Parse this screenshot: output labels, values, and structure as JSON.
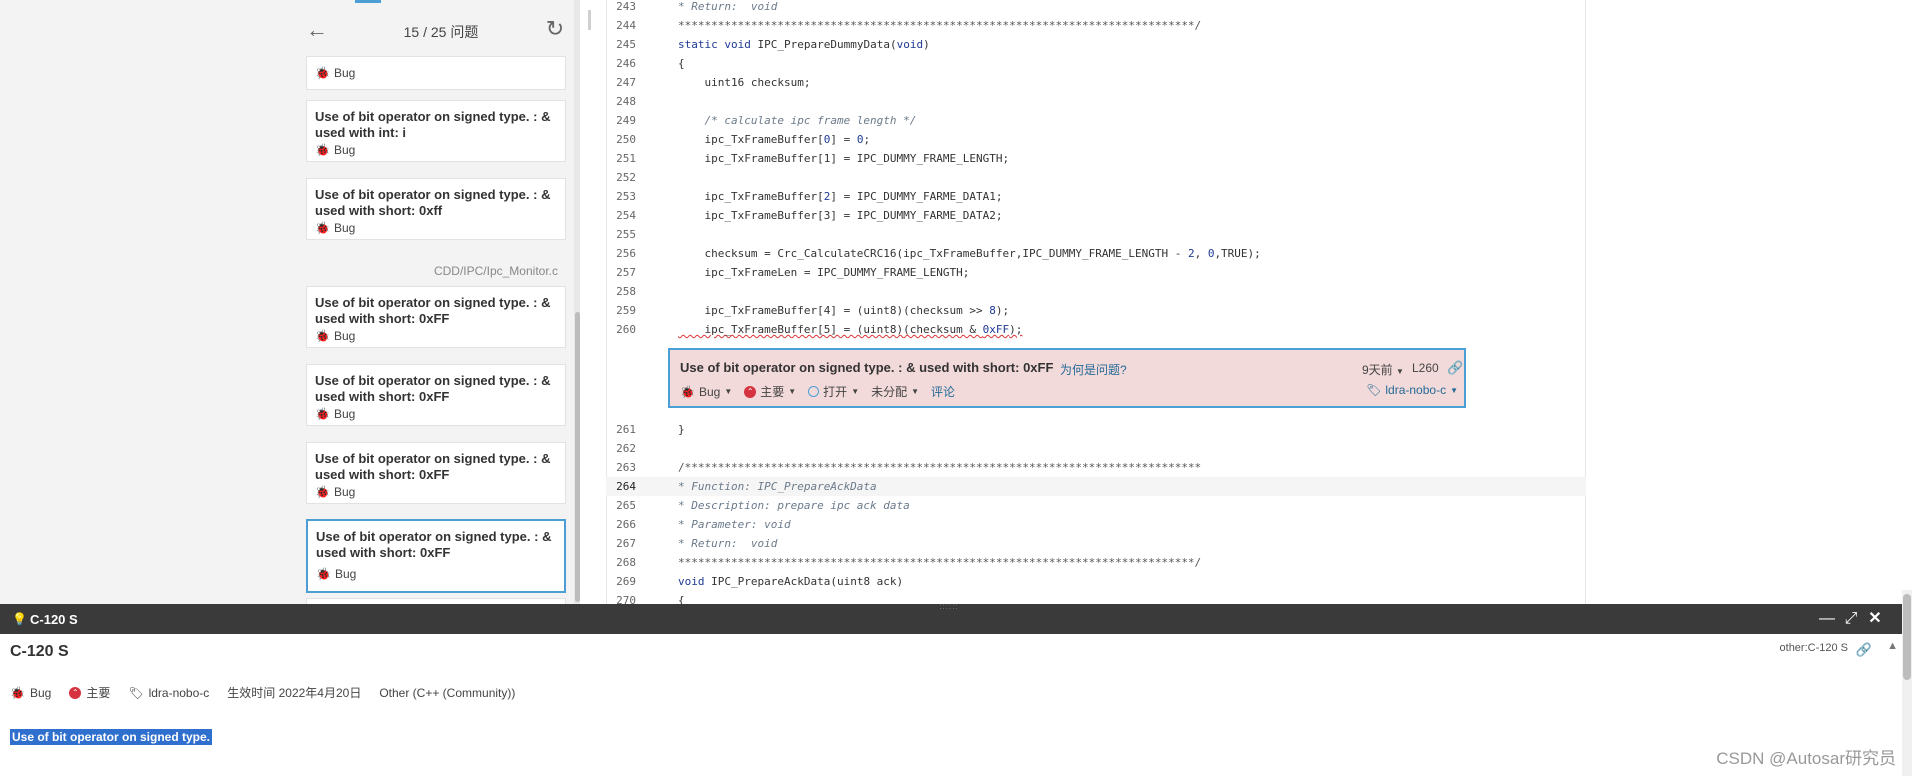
{
  "nav": {
    "counter": "15 / 25 问题",
    "back_icon": "arrow-left-icon",
    "refresh_icon": "refresh-icon"
  },
  "issue_list": {
    "items": [
      {
        "message": "",
        "type": "Bug"
      },
      {
        "message": "Use of bit operator on signed type. : & used with int: i",
        "type": "Bug"
      },
      {
        "message": "Use of bit operator on signed type. : & used with short: 0xff",
        "type": "Bug"
      },
      {
        "message": "Use of bit operator on signed type. : & used with short: 0xFF",
        "type": "Bug"
      },
      {
        "message": "Use of bit operator on signed type. : & used with short: 0xFF",
        "type": "Bug"
      },
      {
        "message": "Use of bit operator on signed type. : & used with short: 0xFF",
        "type": "Bug"
      },
      {
        "message": "Use of bit operator on signed type. : & used with short: 0xFF",
        "type": "Bug"
      }
    ],
    "file_header": "CDD/IPC/Ipc_Monitor.c",
    "selected_index": 6
  },
  "code": {
    "lines": [
      {
        "n": "243",
        "text": "* Return:  void",
        "style": "comment"
      },
      {
        "n": "244",
        "text": "******************************************************************************/",
        "style": "plain-comment"
      },
      {
        "n": "245",
        "text": "static void IPC_PrepareDummyData(void)",
        "style": "code"
      },
      {
        "n": "246",
        "text": "{",
        "style": "code"
      },
      {
        "n": "247",
        "text": "    uint16 checksum;",
        "style": "code"
      },
      {
        "n": "248",
        "text": "",
        "style": "code"
      },
      {
        "n": "249",
        "text": "    /* calculate ipc frame length */",
        "style": "comment"
      },
      {
        "n": "250",
        "text": "    ipc_TxFrameBuffer[0] = 0;",
        "style": "code"
      },
      {
        "n": "251",
        "text": "    ipc_TxFrameBuffer[1] = IPC_DUMMY_FRAME_LENGTH;",
        "style": "code"
      },
      {
        "n": "252",
        "text": "",
        "style": "code"
      },
      {
        "n": "253",
        "text": "    ipc_TxFrameBuffer[2] = IPC_DUMMY_FARME_DATA1;",
        "style": "code"
      },
      {
        "n": "254",
        "text": "    ipc_TxFrameBuffer[3] = IPC_DUMMY_FARME_DATA2;",
        "style": "code"
      },
      {
        "n": "255",
        "text": "",
        "style": "code"
      },
      {
        "n": "256",
        "text": "    checksum = Crc_CalculateCRC16(ipc_TxFrameBuffer,IPC_DUMMY_FRAME_LENGTH - 2, 0,TRUE);",
        "style": "code"
      },
      {
        "n": "257",
        "text": "    ipc_TxFrameLen = IPC_DUMMY_FRAME_LENGTH;",
        "style": "code"
      },
      {
        "n": "258",
        "text": "",
        "style": "code"
      },
      {
        "n": "259",
        "text": "    ipc_TxFrameBuffer[4] = (uint8)(checksum >> 8);",
        "style": "code"
      },
      {
        "n": "260",
        "text": "    ipc_TxFrameBuffer[5] = (uint8)(checksum & 0xFF);",
        "style": "code"
      },
      {
        "n": "261",
        "text": "}",
        "style": "code"
      },
      {
        "n": "262",
        "text": "",
        "style": "code"
      },
      {
        "n": "263",
        "text": "/******************************************************************************",
        "style": "plain-comment"
      },
      {
        "n": "264",
        "text": "* Function: IPC_PrepareAckData",
        "style": "comment"
      },
      {
        "n": "265",
        "text": "* Description: prepare ipc ack data",
        "style": "comment"
      },
      {
        "n": "266",
        "text": "* Parameter: void",
        "style": "comment"
      },
      {
        "n": "267",
        "text": "* Return:  void",
        "style": "comment"
      },
      {
        "n": "268",
        "text": "******************************************************************************/",
        "style": "plain-comment"
      },
      {
        "n": "269",
        "text": "void IPC_PrepareAckData(uint8 ack)",
        "style": "code"
      },
      {
        "n": "270",
        "text": "{",
        "style": "code"
      }
    ]
  },
  "inline_issue": {
    "message": "Use of bit operator on signed type. : & used with short: 0xFF",
    "why_link": "为何是问题?",
    "age": "9天前",
    "line": "L260",
    "type": "Bug",
    "severity": "主要",
    "status": "打开",
    "assignee": "未分配",
    "comment": "评论",
    "tags": "ldra-nobo-c"
  },
  "rule_panel": {
    "header_title": "C-120 S",
    "title": "C-120 S",
    "rule_key": "other:C-120 S",
    "type": "Bug",
    "severity": "主要",
    "tags": "ldra-nobo-c",
    "effective_date": "生效时间 2022年4月20日",
    "language": "Other (C++ (Community))",
    "description": "Use of bit operator on signed type."
  },
  "watermark": "CSDN @Autosar研究员",
  "colors": {
    "accent": "#4b9fd5",
    "issue_bg": "#f3dada",
    "major_red": "#d4333f",
    "link": "#236a97",
    "panel_header": "#3a3a3a"
  }
}
